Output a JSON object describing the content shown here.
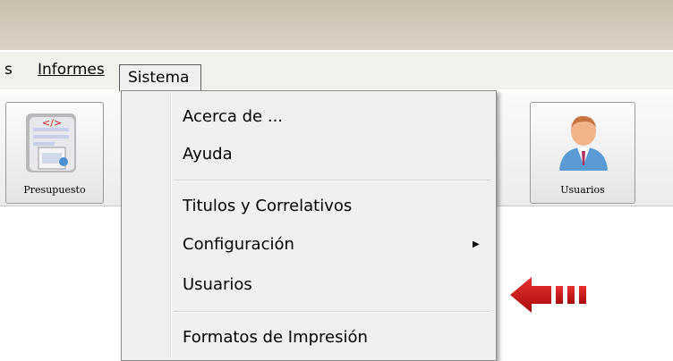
{
  "menubar": {
    "items": [
      {
        "label": "s"
      },
      {
        "label": "Informes"
      },
      {
        "label": "Sistema"
      }
    ]
  },
  "toolbar": {
    "buttons": [
      {
        "label": "Presupuesto",
        "icon": "budget-document-icon"
      },
      {
        "label": "Usuarios",
        "icon": "user-icon"
      }
    ]
  },
  "dropdown": {
    "items": [
      {
        "label": "Acerca de ..."
      },
      {
        "label": "Ayuda"
      },
      {
        "label": "Titulos y Correlativos"
      },
      {
        "label": "Configuración",
        "submenu": true
      },
      {
        "label": "Usuarios"
      },
      {
        "label": "Formatos de Impresión"
      }
    ]
  },
  "annotation": {
    "icon": "red-arrow-icon",
    "color": "#cc1111"
  }
}
